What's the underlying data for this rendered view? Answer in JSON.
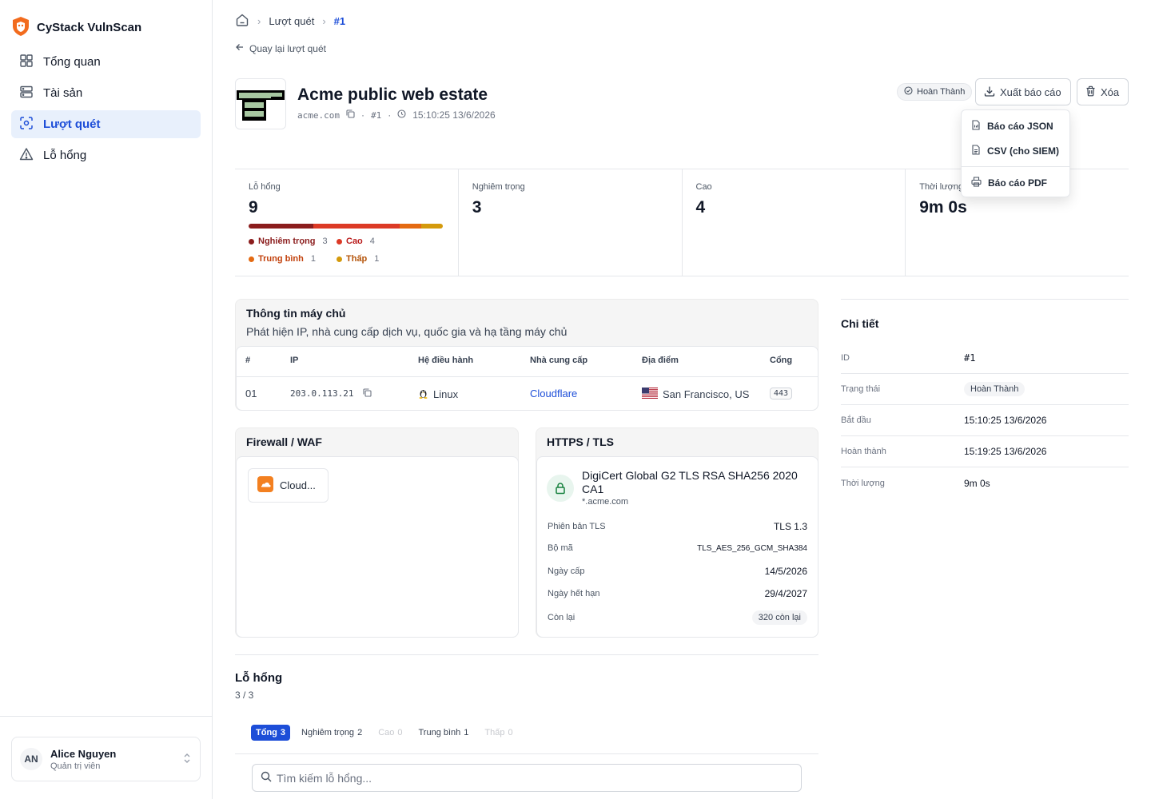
{
  "app": {
    "name": "CyStack VulnScan"
  },
  "sidebar": {
    "items": [
      {
        "label": "Tổng quan"
      },
      {
        "label": "Tài sản"
      },
      {
        "label": "Lượt quét"
      },
      {
        "label": "Lỗ hổng"
      }
    ],
    "user": {
      "initials": "AN",
      "name": "Alice Nguyen",
      "role": "Quản trị viên"
    }
  },
  "breadcrumb": {
    "section": "Lượt quét",
    "current": "#1"
  },
  "back_link": "Quay lại lượt quét",
  "asset": {
    "title": "Acme public web estate",
    "domain": "acme.com",
    "scan_id": "#1",
    "timestamp": "15:10:25 13/6/2026",
    "dot": "·"
  },
  "status": "Hoàn Thành",
  "actions": {
    "export": "Xuất báo cáo",
    "delete": "Xóa"
  },
  "export_menu": {
    "json": "Báo cáo JSON",
    "csv": "CSV (cho SIEM)",
    "pdf": "Báo cáo PDF"
  },
  "stats": {
    "vulns_label": "Lỗ hổng",
    "vulns_value": "9",
    "critical_label": "Nghiêm trọng",
    "critical_value": "3",
    "high_label": "Cao",
    "high_value": "4",
    "duration_label": "Thời lượng",
    "duration_value": "9m 0s",
    "severity": [
      {
        "label": "Nghiêm trọng",
        "count": "3",
        "color": "#8b1d1d",
        "share": 3
      },
      {
        "label": "Cao",
        "count": "4",
        "color": "#dc3a26",
        "share": 4
      },
      {
        "label": "Trung bình",
        "count": "1",
        "color": "#e46a12",
        "share": 1
      },
      {
        "label": "Thấp",
        "count": "1",
        "color": "#d49a0c",
        "share": 1
      }
    ]
  },
  "host_info": {
    "title": "Thông tin máy chủ",
    "subtitle": "Phát hiện IP, nhà cung cấp dịch vụ, quốc gia và hạ tầng máy chủ",
    "columns": [
      "#",
      "IP",
      "Hệ điều hành",
      "Nhà cung cấp",
      "Địa điểm",
      "Cổng"
    ],
    "row": {
      "index": "01",
      "ip": "203.0.113.21",
      "os": "Linux",
      "provider": "Cloudflare",
      "location": "San Francisco, US",
      "port": "443"
    }
  },
  "firewall": {
    "title": "Firewall / WAF",
    "name": "Cloud..."
  },
  "tls": {
    "title": "HTTPS / TLS",
    "issuer": "DigiCert Global G2 TLS RSA SHA256 2020 CA1",
    "subject": "*.acme.com",
    "rows": [
      {
        "label": "Phiên bản TLS",
        "value": "TLS 1.3"
      },
      {
        "label": "Bộ mã",
        "value": "TLS_AES_256_GCM_SHA384"
      },
      {
        "label": "Ngày cấp",
        "value": "14/5/2026"
      },
      {
        "label": "Ngày hết hạn",
        "value": "29/4/2027"
      },
      {
        "label": "Còn lại",
        "value": "320 còn lại"
      }
    ]
  },
  "details": {
    "title": "Chi tiết",
    "rows": [
      {
        "label": "ID",
        "value": "#1"
      },
      {
        "label": "Trạng thái",
        "value": "Hoàn Thành"
      },
      {
        "label": "Bắt đầu",
        "value": "15:10:25 13/6/2026"
      },
      {
        "label": "Hoàn thành",
        "value": "15:19:25 13/6/2026"
      },
      {
        "label": "Thời lượng",
        "value": "9m 0s"
      }
    ]
  },
  "vulns": {
    "title": "Lỗ hổng",
    "count": "3 / 3",
    "tabs": [
      {
        "label": "Tổng",
        "count": "3"
      },
      {
        "label": "Nghiêm trọng",
        "count": "2"
      },
      {
        "label": "Cao",
        "count": "0"
      },
      {
        "label": "Trung bình",
        "count": "1"
      },
      {
        "label": "Thấp",
        "count": "0"
      }
    ],
    "search_placeholder": "Tìm kiếm lỗ hổng..."
  }
}
